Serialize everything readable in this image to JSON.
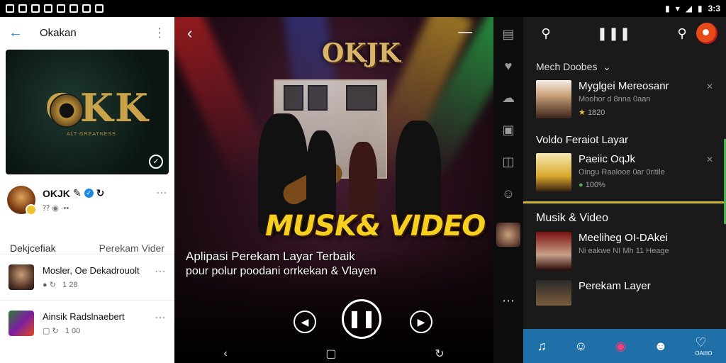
{
  "status": {
    "time": "3:3"
  },
  "left": {
    "title": "Okakan",
    "channel": {
      "name": "OKJK",
      "meta": "⁇ ◉ ·••"
    },
    "tabs": [
      "Dekjcefiak",
      "Perekam Vider"
    ],
    "rows": [
      {
        "title": "Mosler, Oe Dekadrouolt",
        "meta": "1 28"
      },
      {
        "title": "Ainsik Radslnaebert",
        "meta": "1 00"
      }
    ],
    "thumb_logo": "OKK",
    "thumb_sub": "ALT GREATNESS"
  },
  "video": {
    "logo": "OKJK",
    "big_title": "MUSK& VIDEO",
    "subtitle1": "Aplipasi Perekam Layar Terbaik",
    "subtitle2": "pour polur poodani orrkekan & Vlayen"
  },
  "right": {
    "section1": "Mech Doobes",
    "items1": [
      {
        "title": "Myglgei Mereosanr",
        "meta": "Moohor d 8nna 0aan",
        "meta2": "1820"
      }
    ],
    "section2": "Voldo Feraiot Layar",
    "items2": [
      {
        "title": "Paeiic OqJk",
        "meta": "Oingu Raalooe 0ar 0ritile",
        "meta2": "100%"
      }
    ],
    "section3": "Musik & Video",
    "items3": [
      {
        "title": "Meeliheg OI-DAkei",
        "meta": "Ni eakwe NI Mh 11 Heage"
      },
      {
        "title": "Perekam Layer",
        "meta": ""
      }
    ],
    "nav_label": "OAiIIO"
  }
}
